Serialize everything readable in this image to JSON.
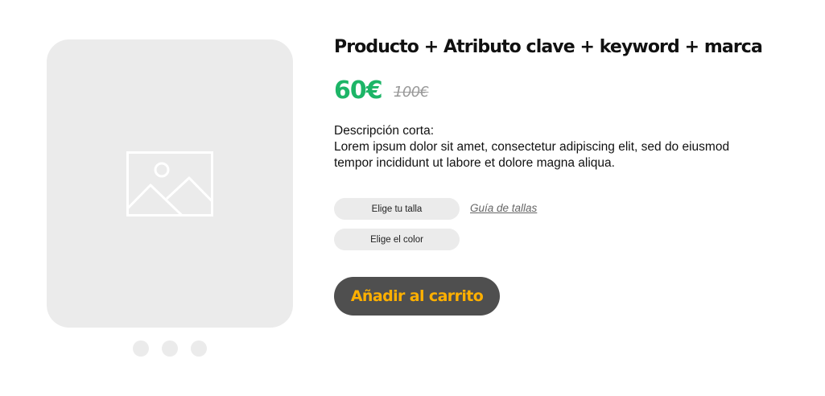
{
  "product": {
    "title": "Producto + Atributo clave + keyword + marca",
    "price": "60€",
    "old_price": "100€",
    "description_label": "Descripción corta:",
    "description_lines": [
      "Lorem ipsum dolor sit amet, consectetur adipiscing elit, sed do eiusmod",
      "tempor incididunt ut labore et dolore magna aliqua."
    ]
  },
  "gallery": {
    "image_icon": "image-placeholder-icon",
    "dot_count": 3
  },
  "options": {
    "size_label": "Elige tu talla",
    "size_guide_label": "Guía de tallas",
    "color_label": "Elige el color"
  },
  "cart": {
    "button_label": "Añadir al carrito"
  },
  "colors": {
    "price": "#1db567",
    "old_price": "#999999",
    "placeholder_bg": "#ebebeb",
    "button_bg": "#4f4f4f",
    "button_text": "#ffb000"
  }
}
